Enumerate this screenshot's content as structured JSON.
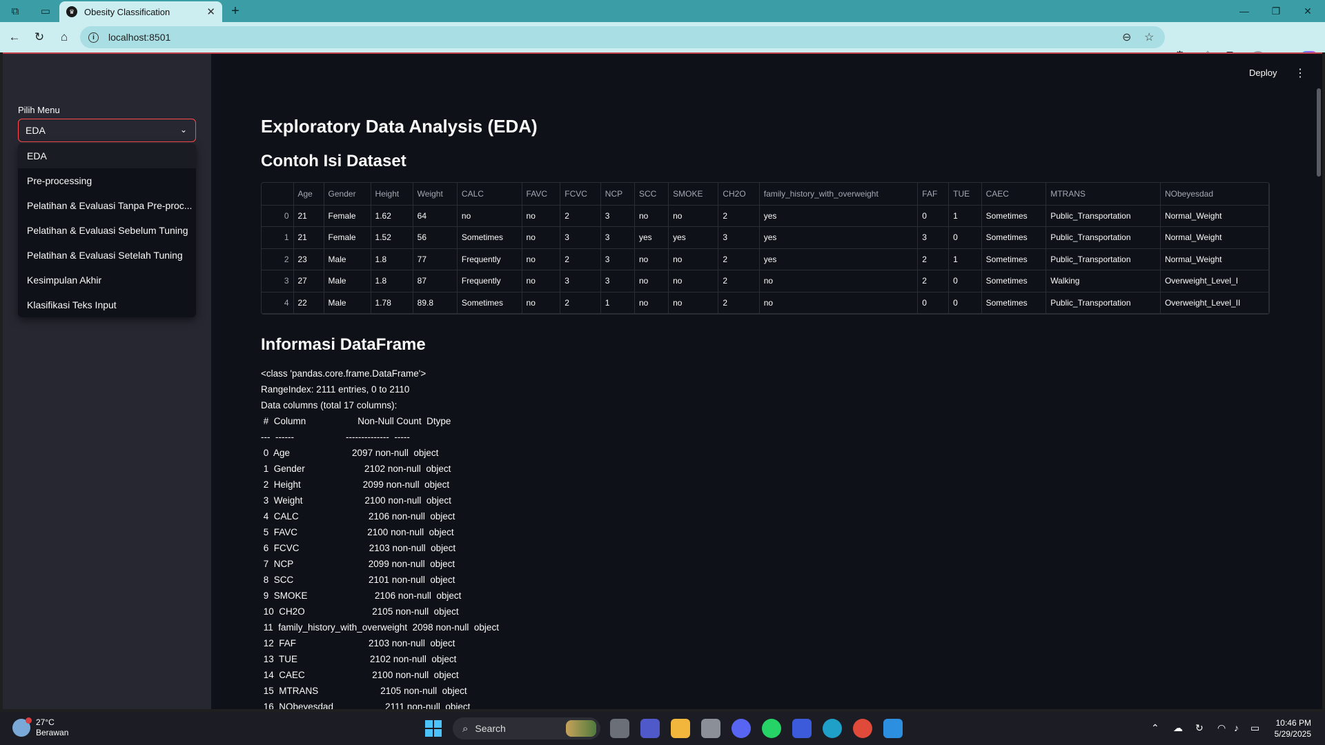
{
  "browser": {
    "tab_title": "Obesity Classification",
    "url": "localhost:8501"
  },
  "app": {
    "deploy_label": "Deploy",
    "sidebar": {
      "menu_label": "Pilih Menu",
      "selected": "EDA",
      "options": [
        "EDA",
        "Pre-processing",
        "Pelatihan & Evaluasi Tanpa Pre-proc...",
        "Pelatihan & Evaluasi Sebelum Tuning",
        "Pelatihan & Evaluasi Setelah Tuning",
        "Kesimpulan Akhir",
        "Klasifikasi Teks Input"
      ]
    },
    "title": "Exploratory Data Analysis (EDA)",
    "dataset_heading": "Contoh Isi Dataset",
    "table": {
      "columns": [
        "",
        "Age",
        "Gender",
        "Height",
        "Weight",
        "CALC",
        "FAVC",
        "FCVC",
        "NCP",
        "SCC",
        "SMOKE",
        "CH2O",
        "family_history_with_overweight",
        "FAF",
        "TUE",
        "CAEC",
        "MTRANS",
        "NObeyesdad"
      ],
      "rows": [
        [
          "0",
          "21",
          "Female",
          "1.62",
          "64",
          "no",
          "no",
          "2",
          "3",
          "no",
          "no",
          "2",
          "yes",
          "0",
          "1",
          "Sometimes",
          "Public_Transportation",
          "Normal_Weight"
        ],
        [
          "1",
          "21",
          "Female",
          "1.52",
          "56",
          "Sometimes",
          "no",
          "3",
          "3",
          "yes",
          "yes",
          "3",
          "yes",
          "3",
          "0",
          "Sometimes",
          "Public_Transportation",
          "Normal_Weight"
        ],
        [
          "2",
          "23",
          "Male",
          "1.8",
          "77",
          "Frequently",
          "no",
          "2",
          "3",
          "no",
          "no",
          "2",
          "yes",
          "2",
          "1",
          "Sometimes",
          "Public_Transportation",
          "Normal_Weight"
        ],
        [
          "3",
          "27",
          "Male",
          "1.8",
          "87",
          "Frequently",
          "no",
          "3",
          "3",
          "no",
          "no",
          "2",
          "no",
          "2",
          "0",
          "Sometimes",
          "Walking",
          "Overweight_Level_I"
        ],
        [
          "4",
          "22",
          "Male",
          "1.78",
          "89.8",
          "Sometimes",
          "no",
          "2",
          "1",
          "no",
          "no",
          "2",
          "no",
          "0",
          "0",
          "Sometimes",
          "Public_Transportation",
          "Overweight_Level_II"
        ]
      ]
    },
    "info_heading": "Informasi DataFrame",
    "info_lines": [
      "<class 'pandas.core.frame.DataFrame'>",
      "RangeIndex: 2111 entries, 0 to 2110",
      "Data columns (total 17 columns):",
      " #  Column                    Non-Null Count  Dtype",
      "---  ------                    --------------  -----",
      " 0  Age                        2097 non-null  object",
      " 1  Gender                       2102 non-null  object",
      " 2  Height                        2099 non-null  object",
      " 3  Weight                        2100 non-null  object",
      " 4  CALC                           2106 non-null  object",
      " 5  FAVC                           2100 non-null  object",
      " 6  FCVC                           2103 non-null  object",
      " 7  NCP                             2099 non-null  object",
      " 8  SCC                             2101 non-null  object",
      " 9  SMOKE                          2106 non-null  object",
      " 10  CH2O                          2105 non-null  object",
      " 11  family_history_with_overweight  2098 non-null  object",
      " 12  FAF                            2103 non-null  object",
      " 13  TUE                            2102 non-null  object",
      " 14  CAEC                          2100 non-null  object",
      " 15  MTRANS                        2105 non-null  object",
      " 16  NObeyesdad                    2111 non-null  object"
    ]
  },
  "taskbar": {
    "weather_temp": "27°C",
    "weather_desc": "Berawan",
    "search_placeholder": "Search",
    "time": "10:46 PM",
    "date": "5/29/2025"
  }
}
